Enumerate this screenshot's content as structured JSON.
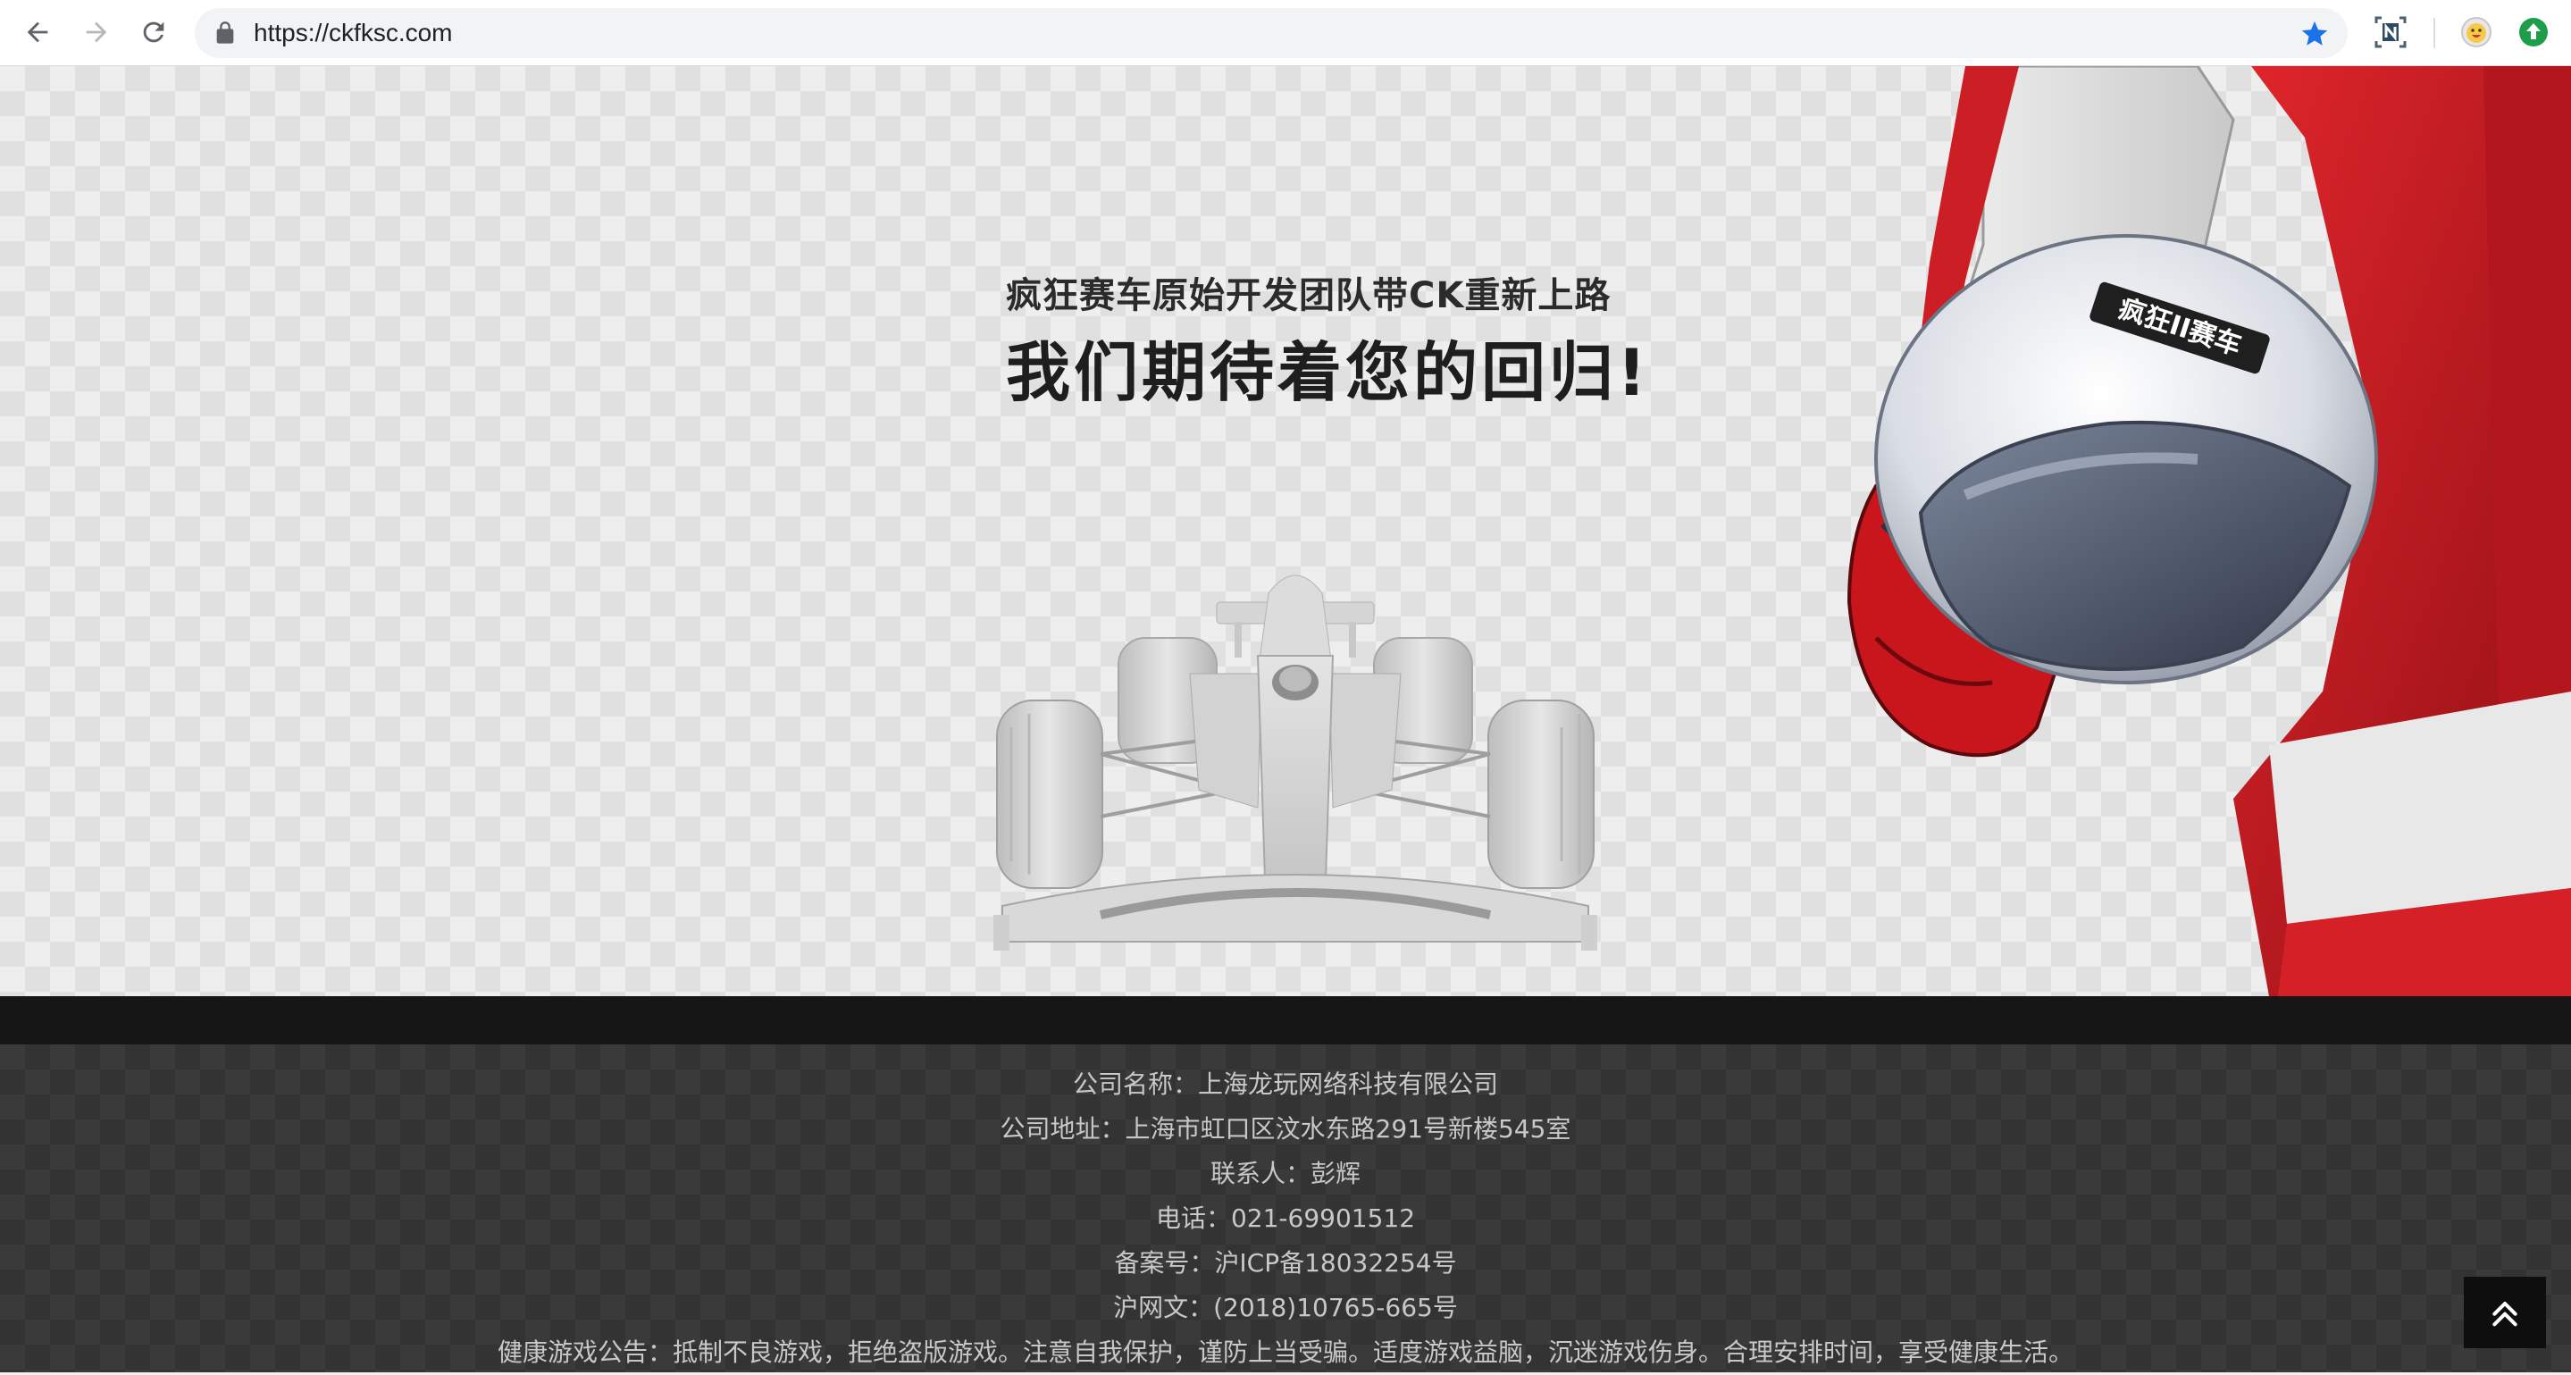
{
  "browser": {
    "url": "https://ckfksc.com",
    "icons": {
      "back": "arrow-left-icon",
      "forward": "arrow-right-icon",
      "reload": "reload-icon",
      "secure": "lock-icon",
      "bookmark": "star-icon",
      "extension_1": "n-extension-icon",
      "extension_2": "emoji-face-icon",
      "extension_3": "upload-arrow-icon"
    },
    "accent_color": "#1a73e8"
  },
  "hero": {
    "tagline": "疯狂赛车原始开发团队带CK重新上路",
    "headline": "我们期待着您的回归!",
    "helmet_logo": "疯狂II赛车"
  },
  "footer": {
    "lines": [
      "公司名称：上海龙玩网络科技有限公司",
      "公司地址：上海市虹口区汶水东路291号新楼545室",
      "联系人：彭辉",
      "电话：021-69901512",
      "备案号：沪ICP备18032254号",
      "沪网文：(2018)10765-665号",
      "健康游戏公告：抵制不良游戏，拒绝盗版游戏。注意自我保护，谨防上当受骗。适度游戏益脑，沉迷游戏伤身。合理安排时间，享受健康生活。"
    ],
    "back_to_top_icon": "double-chevron-up-icon"
  }
}
